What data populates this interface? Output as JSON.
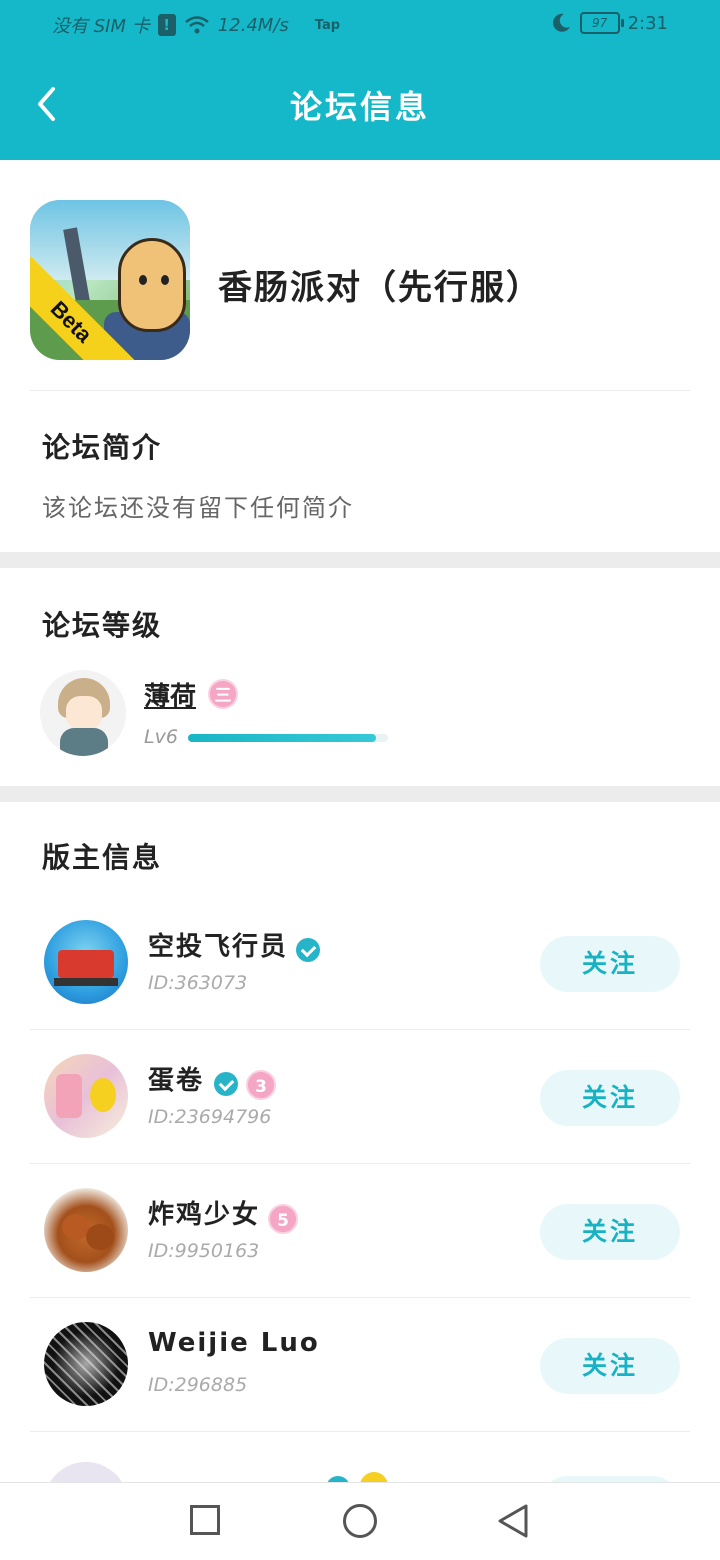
{
  "status_bar": {
    "carrier": "没有 SIM 卡",
    "alert": "!",
    "speed": "12.4M/s",
    "app_badge": "Tap",
    "battery": "97",
    "time": "2:31"
  },
  "header": {
    "title": "论坛信息",
    "back_icon": "chevron-left-icon"
  },
  "game": {
    "name": "香肠派对（先行服）",
    "badge": "Beta"
  },
  "intro": {
    "title": "论坛简介",
    "text": "该论坛还没有留下任何简介"
  },
  "level": {
    "title": "论坛等级",
    "user_name": "薄荷",
    "rank_badge": "三",
    "level_label": "Lv6",
    "progress": 0.94
  },
  "moderators": {
    "title": "版主信息",
    "follow_label": "关注",
    "items": [
      {
        "name": "空投飞行员",
        "id": "ID:363073",
        "verified": true
      },
      {
        "name": "蛋卷",
        "id": "ID:23694796",
        "verified": true,
        "rank_badge": "3"
      },
      {
        "name": "炸鸡少女",
        "id": "ID:9950163",
        "rank_badge": "5"
      },
      {
        "name": "Weijie Luo",
        "id": "ID:296885"
      }
    ]
  },
  "colors": {
    "accent": "#15b8c8",
    "follow_bg": "#e8f8fa",
    "badge_pink": "#f4a6c4"
  },
  "nav": {
    "recent_icon": "square-icon",
    "home_icon": "circle-icon",
    "back_icon": "triangle-back-icon"
  }
}
